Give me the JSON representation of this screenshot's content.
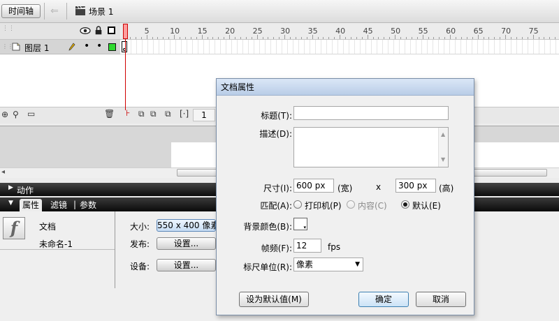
{
  "toolbar": {
    "timeline_button": "时间轴",
    "scene_label": "场景 1"
  },
  "timeline": {
    "ruler_numbers": [
      "1",
      "5",
      "10",
      "15",
      "20",
      "25",
      "30",
      "35",
      "40",
      "45",
      "50",
      "55",
      "60",
      "65",
      "70",
      "75"
    ],
    "layer_name": "图层 1",
    "current_frame": "1",
    "layer_color": "#2fd92f",
    "playhead_color": "#cc0000"
  },
  "panels": {
    "actions_label": "动作",
    "tabs": [
      "属性",
      "滤镜",
      "参数"
    ],
    "doc_label": "文档",
    "doc_name": "未命名-1",
    "size_label": "大小:",
    "size_value": "550 x 400 像素",
    "publish_label": "发布:",
    "publish_button": "设置...",
    "device_label": "设备:",
    "device_button": "设置..."
  },
  "dialog": {
    "title": "文档属性",
    "title_label": "标题(T):",
    "desc_label": "描述(D):",
    "size_label": "尺寸(I):",
    "width_value": "600 px",
    "width_unit": "(宽)",
    "x_sep": "x",
    "height_value": "300 px",
    "height_unit": "(高)",
    "match_label": "匹配(A):",
    "match_options": [
      "打印机(P)",
      "内容(C)",
      "默认(E)"
    ],
    "match_selected": "默认(E)",
    "bg_label": "背景颜色(B):",
    "bg_color": "#ffffff",
    "fps_label": "帧频(F):",
    "fps_value": "12",
    "fps_unit": "fps",
    "ruler_label": "标尺单位(R):",
    "ruler_value": "像素",
    "set_default_button": "设为默认值(M)",
    "ok_button": "确定",
    "cancel_button": "取消"
  }
}
